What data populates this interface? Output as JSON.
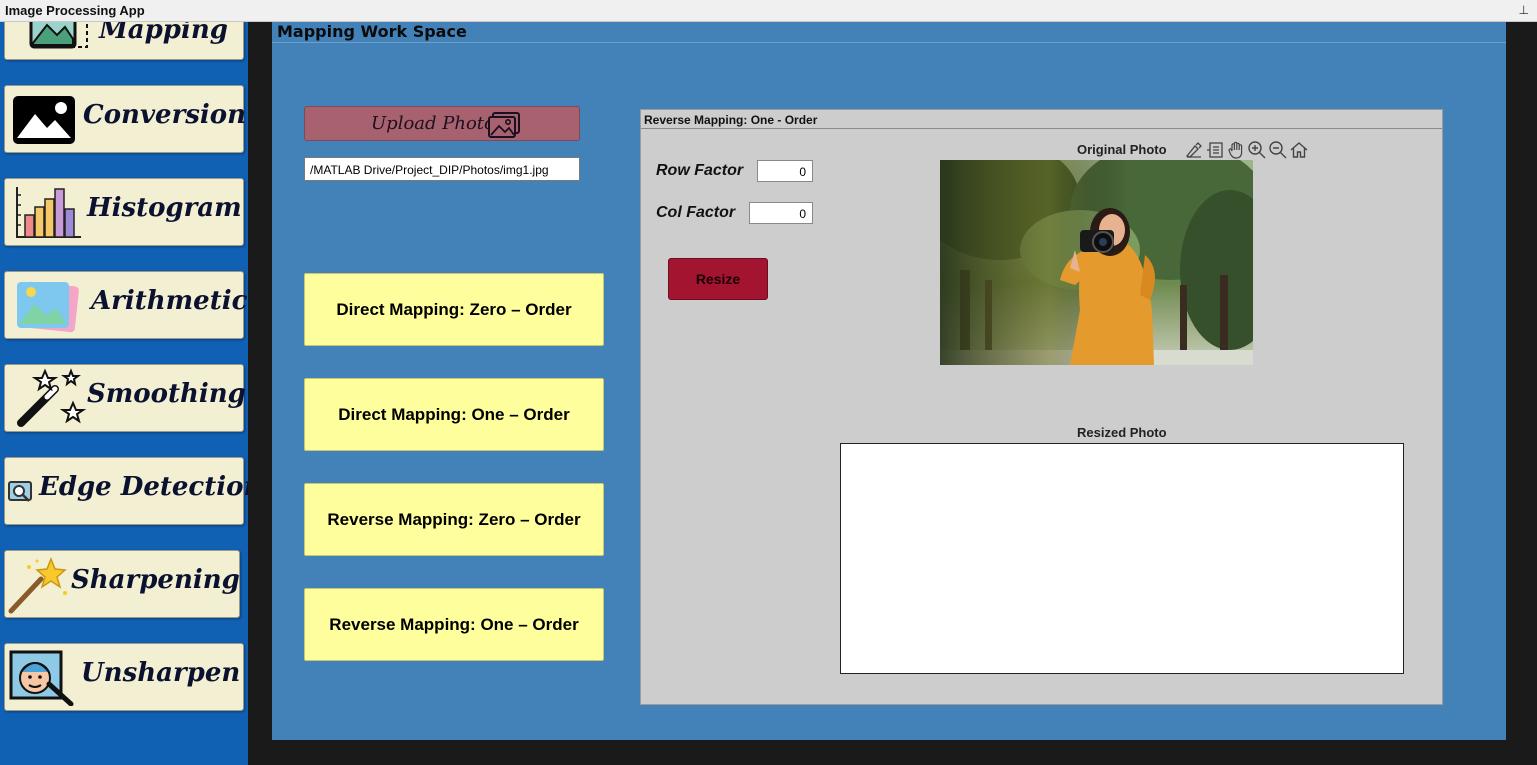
{
  "window": {
    "title": "Image Processing App",
    "pin_glyph": "⊥"
  },
  "sidebar": {
    "items": [
      {
        "label": "Mapping",
        "icon": "mapping-icon"
      },
      {
        "label": "Conversion",
        "icon": "image-icon"
      },
      {
        "label": "Histogram",
        "icon": "histogram-icon"
      },
      {
        "label": "Arithmetic",
        "icon": "photos-icon"
      },
      {
        "label": "Smoothing",
        "icon": "magic-wand-stars-icon"
      },
      {
        "label": "Edge Detection",
        "icon": "edge-detection-icon"
      },
      {
        "label": "Sharpening",
        "icon": "magic-wand-icon"
      },
      {
        "label": "Unsharpen",
        "icon": "face-wand-icon"
      }
    ]
  },
  "workspace": {
    "title": "Mapping Work Space",
    "upload": {
      "label": "Upload Photo",
      "icon": "photo-icon"
    },
    "file_path": "/MATLAB Drive/Project_DIP/Photos/img1.jpg",
    "mapping_buttons": [
      "Direct Mapping: Zero – Order",
      "Direct Mapping: One – Order",
      "Reverse Mapping: Zero – Order",
      "Reverse Mapping: One – Order"
    ]
  },
  "panel": {
    "title": "Reverse Mapping: One - Order",
    "row_factor": {
      "label": "Row Factor",
      "value": "0"
    },
    "col_factor": {
      "label": "Col Factor",
      "value": "0"
    },
    "resize_label": "Resize",
    "original_title": "Original Photo",
    "resized_title": "Resized Photo",
    "axes_toolbar": [
      "brush-icon",
      "data-tips-icon",
      "pan-hand-icon",
      "zoom-in-icon",
      "zoom-out-icon",
      "home-icon"
    ]
  },
  "colors": {
    "sidebar_bg": "#1060b4",
    "workspace_bg": "#4382b9",
    "upload_btn": "#a8616e",
    "mapping_btn": "#fefe9c",
    "resize_btn": "#a2142f",
    "panel_bg": "#cdcdcd"
  }
}
